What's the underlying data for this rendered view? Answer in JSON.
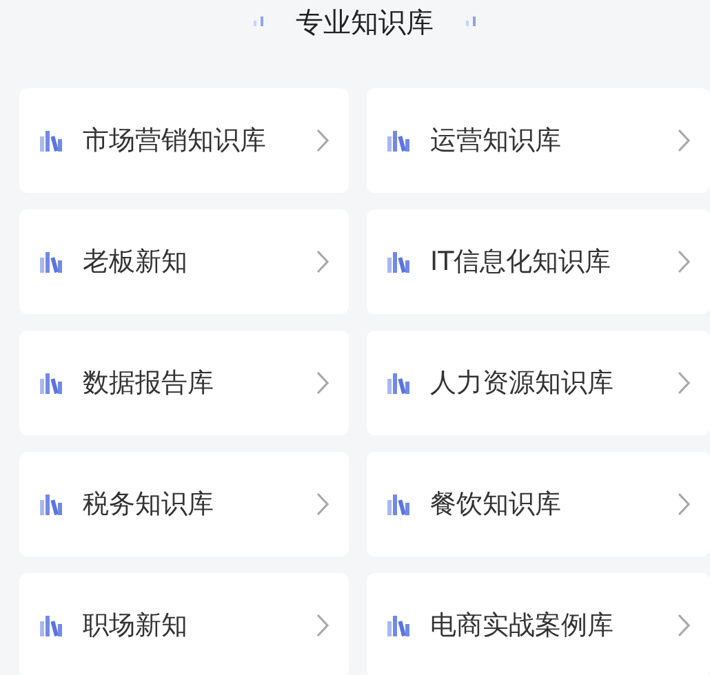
{
  "title": "专业知识库",
  "items": [
    {
      "label": "市场营销知识库"
    },
    {
      "label": "运营知识库"
    },
    {
      "label": "老板新知"
    },
    {
      "label": "IT信息化知识库"
    },
    {
      "label": "数据报告库"
    },
    {
      "label": "人力资源知识库"
    },
    {
      "label": "税务知识库"
    },
    {
      "label": "餐饮知识库"
    },
    {
      "label": "职场新知"
    },
    {
      "label": "电商实战案例库"
    }
  ]
}
